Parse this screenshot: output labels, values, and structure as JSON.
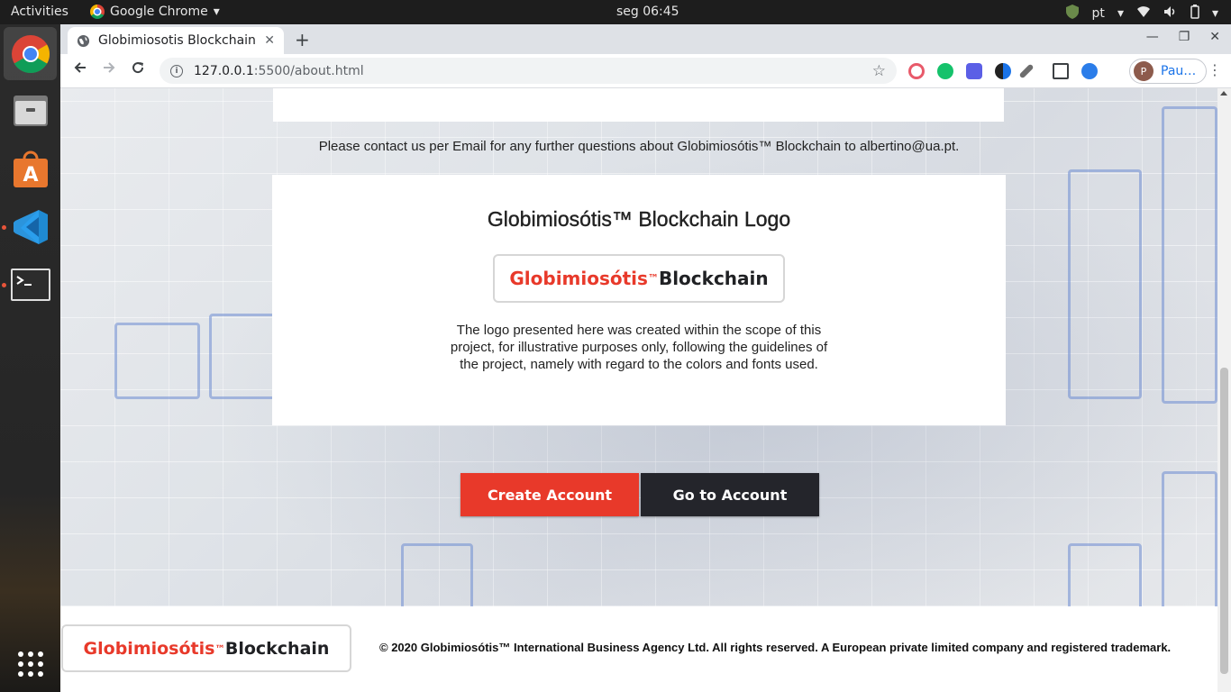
{
  "system_bar": {
    "activities": "Activities",
    "app_name": "Google Chrome",
    "clock": "seg 06:45",
    "language": "pt"
  },
  "dock": {
    "items": [
      "chrome-icon",
      "files-icon",
      "software-icon",
      "vscode-icon",
      "terminal-icon",
      "app-grid-icon"
    ]
  },
  "browser": {
    "tab_title": "Globimiosotis Blockchain",
    "url_host": "127.0.0.1",
    "url_path": ":5500/about.html",
    "profile_initial": "P",
    "profile_name": "Pau…"
  },
  "page": {
    "contact_text": "Please contact us per Email for any further questions about Globimiosótis™ Blockchain to albertino@ua.pt.",
    "logo_section": {
      "title": "Globimiosótis™ Blockchain Logo",
      "logo_red": "Globimiosótis",
      "logo_tm": "™",
      "logo_dark": "Blockchain",
      "description": "The logo presented here was created within the scope of this project, for illustrative purposes only, following the guidelines of the project, namely with regard to the colors and fonts used."
    },
    "buttons": {
      "create": "Create Account",
      "go": "Go to Account"
    },
    "footer": {
      "logo_red": "Globimiosótis",
      "logo_tm": "™",
      "logo_dark": "Blockchain",
      "copyright": "© 2020 Globimiosótis™ International Business Agency Ltd. All rights reserved. A European private limited company and registered trademark."
    }
  },
  "colors": {
    "brand_red": "#e8392a",
    "brand_dark": "#24252b"
  }
}
